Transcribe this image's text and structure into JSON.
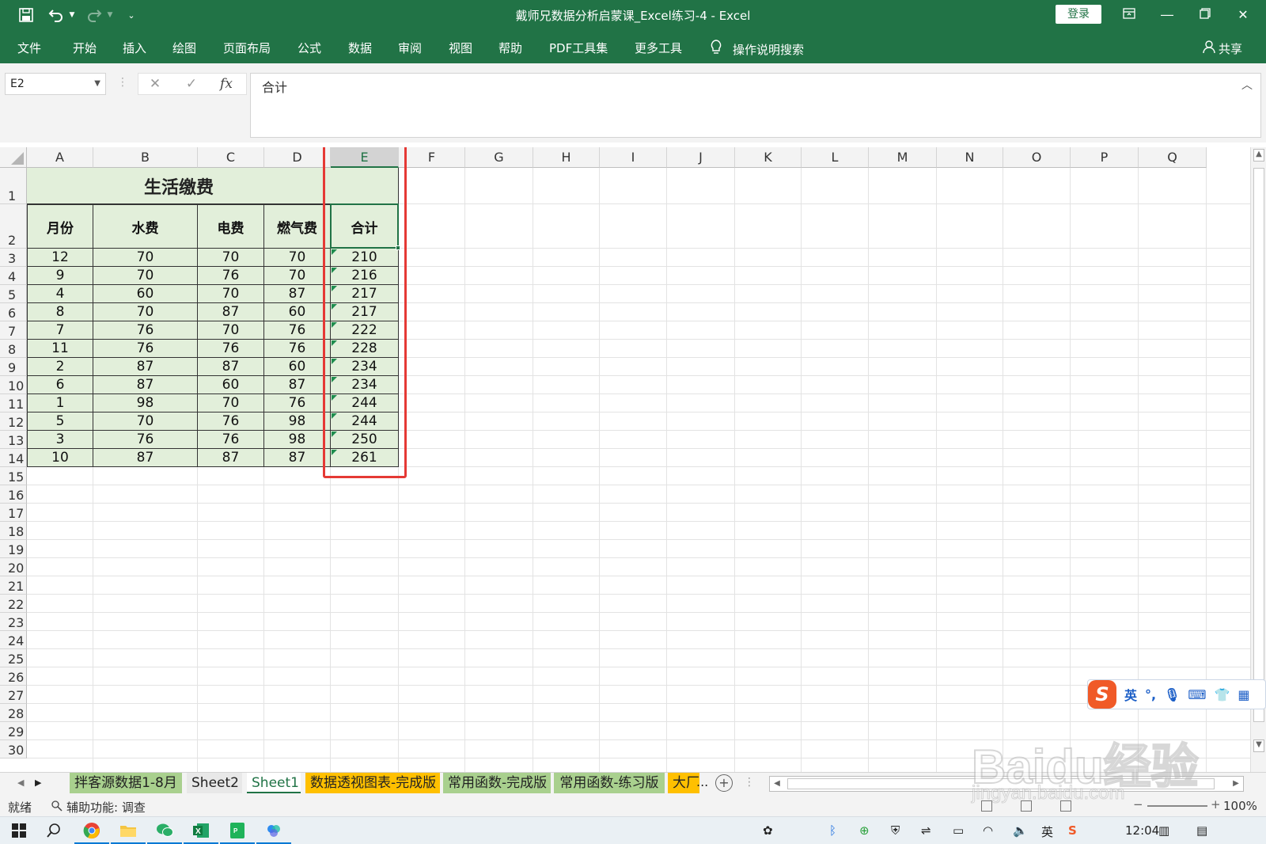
{
  "titlebar": {
    "title": "戴师兄数据分析启蒙课_Excel练习-4  -  Excel",
    "login_label": "登录",
    "accent": "#217346"
  },
  "menu": {
    "items": [
      "文件",
      "开始",
      "插入",
      "绘图",
      "页面布局",
      "公式",
      "数据",
      "审阅",
      "视图",
      "帮助",
      "PDF工具集",
      "更多工具"
    ],
    "tellme": "操作说明搜索",
    "share": "共享"
  },
  "formula_bar": {
    "name_box": "E2",
    "fx_label": "fx",
    "value": "合计"
  },
  "columns": [
    "A",
    "B",
    "C",
    "D",
    "E",
    "F",
    "G",
    "H",
    "I",
    "J",
    "K",
    "L",
    "M",
    "N",
    "O",
    "P",
    "Q"
  ],
  "selected_column": "E",
  "rows": [
    "1",
    "2",
    "3",
    "4",
    "5",
    "6",
    "7",
    "8",
    "9",
    "10",
    "11",
    "12",
    "13",
    "14",
    "15",
    "16",
    "17",
    "18",
    "19",
    "20",
    "21",
    "22",
    "23",
    "24",
    "25",
    "26",
    "27",
    "28",
    "29",
    "30"
  ],
  "table": {
    "title": "生活缴费",
    "headers": [
      "月份",
      "水费",
      "电费",
      "燃气费",
      "合计"
    ],
    "data": [
      [
        "12",
        "70",
        "70",
        "70",
        "210"
      ],
      [
        "9",
        "70",
        "76",
        "70",
        "216"
      ],
      [
        "4",
        "60",
        "70",
        "87",
        "217"
      ],
      [
        "8",
        "70",
        "87",
        "60",
        "217"
      ],
      [
        "7",
        "76",
        "70",
        "76",
        "222"
      ],
      [
        "11",
        "76",
        "76",
        "76",
        "228"
      ],
      [
        "2",
        "87",
        "87",
        "60",
        "234"
      ],
      [
        "6",
        "87",
        "60",
        "87",
        "234"
      ],
      [
        "1",
        "98",
        "70",
        "76",
        "244"
      ],
      [
        "5",
        "70",
        "76",
        "98",
        "244"
      ],
      [
        "3",
        "76",
        "76",
        "98",
        "250"
      ],
      [
        "10",
        "87",
        "87",
        "87",
        "261"
      ]
    ],
    "fill_color": "#e2efda"
  },
  "sheet_tabs": [
    {
      "label": "拌客源数据1-8月",
      "style": "green"
    },
    {
      "label": "Sheet2",
      "style": "gray"
    },
    {
      "label": "Sheet1",
      "style": "active"
    },
    {
      "label": "数据透视图表-完成版",
      "style": "orange"
    },
    {
      "label": "常用函数-完成版",
      "style": "green"
    },
    {
      "label": "常用函数-练习版",
      "style": "green"
    },
    {
      "label": "大厂|",
      "style": "orange"
    }
  ],
  "tabs_more": "...",
  "status": {
    "ready": "就绪",
    "accessibility": "辅助功能: 调查",
    "zoom": "100%"
  },
  "ime": {
    "lang": "英"
  },
  "taskbar": {
    "clock": "12:04"
  },
  "watermark": {
    "line1": "Baidu经验",
    "line2": "jingyan.baidu.com"
  }
}
